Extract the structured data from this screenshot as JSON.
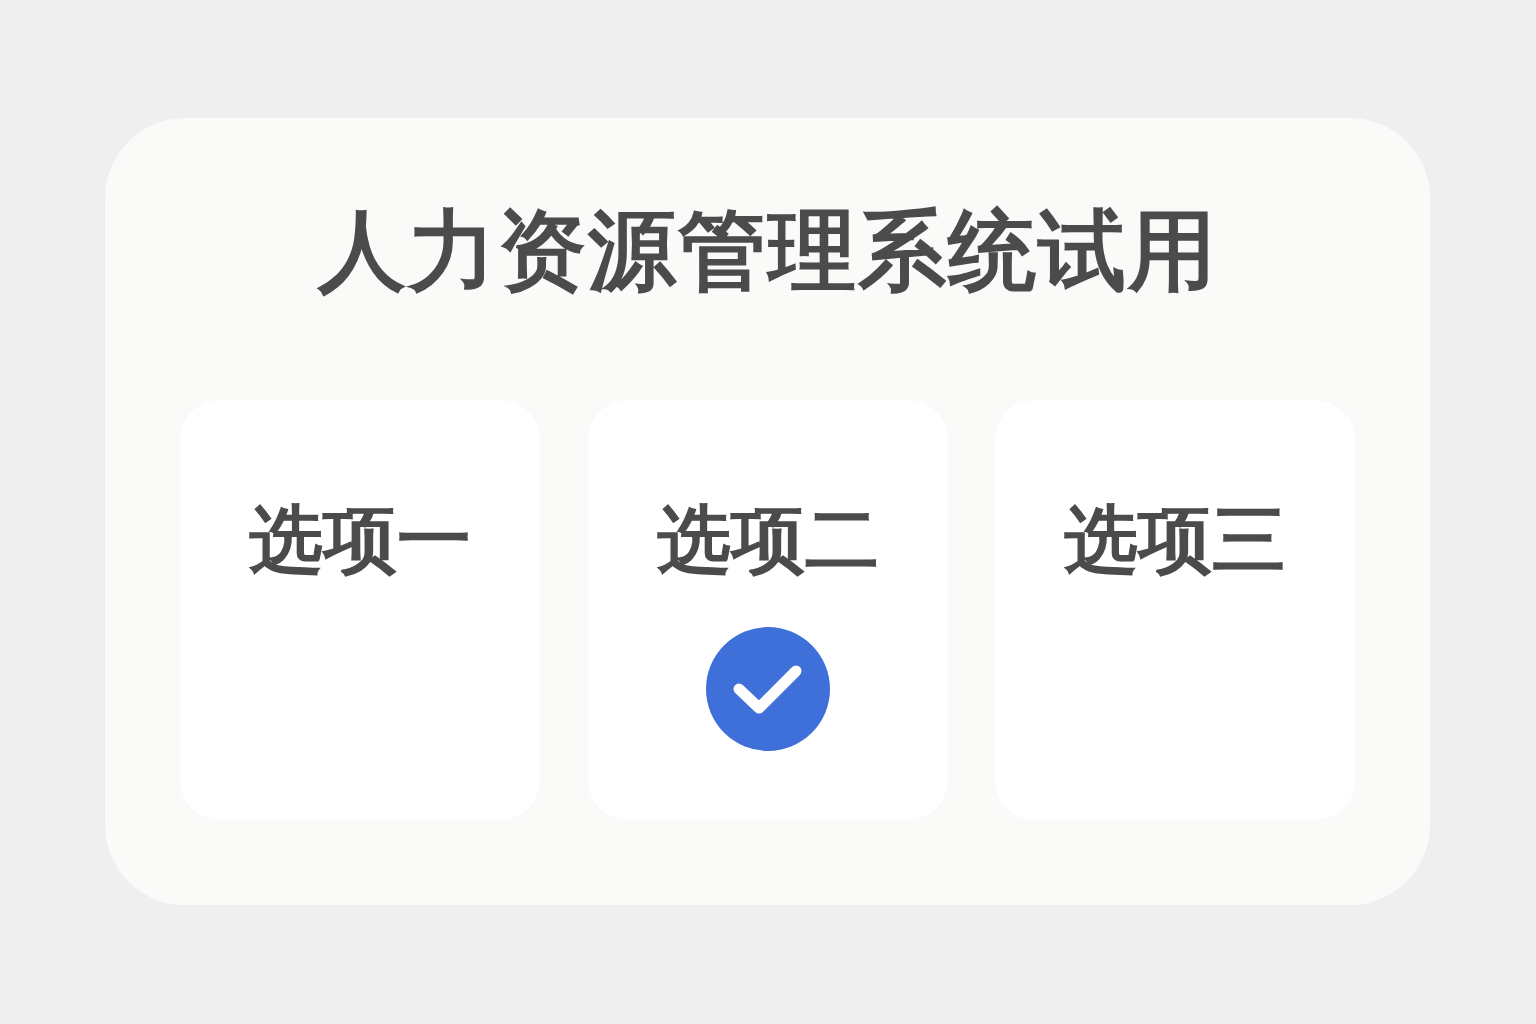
{
  "title": "人力资源管理系统试用",
  "options": [
    {
      "label": "选项一",
      "selected": false
    },
    {
      "label": "选项二",
      "selected": true
    },
    {
      "label": "选项三",
      "selected": false
    }
  ]
}
